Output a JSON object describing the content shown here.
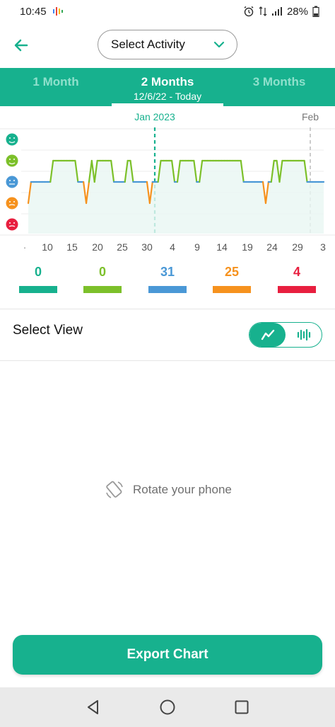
{
  "status_bar": {
    "time": "10:45",
    "battery": "28%"
  },
  "header": {
    "select_activity_label": "Select Activity"
  },
  "tabs": [
    {
      "label": "1 Month",
      "sub": ""
    },
    {
      "label": "2 Months",
      "sub": "12/6/22 - Today"
    },
    {
      "label": "3 Months",
      "sub": ""
    }
  ],
  "chart_data": {
    "type": "line",
    "month_labels": [
      "Jan 2023",
      "Feb"
    ],
    "x_tick_labels": [
      "10",
      "15",
      "20",
      "25",
      "30",
      "4",
      "9",
      "14",
      "19",
      "24",
      "29",
      "3"
    ],
    "y_categories": [
      "rad",
      "good",
      "meh",
      "bad",
      "awful"
    ],
    "y_colors": [
      "#17b18e",
      "#7cc02a",
      "#4a98d6",
      "#f6921e",
      "#e81f3f"
    ],
    "series": [
      {
        "values": [
          1,
          2,
          2,
          2,
          2,
          2,
          2,
          2,
          2,
          3,
          3,
          3,
          3,
          3,
          3,
          3,
          3,
          3,
          2,
          2,
          2,
          1,
          2,
          3,
          2,
          3,
          3,
          3,
          3,
          3,
          3,
          2,
          2,
          2,
          2,
          2,
          3,
          3,
          2,
          2,
          2,
          2,
          2,
          2,
          1,
          2,
          2,
          2,
          3,
          3,
          3,
          3,
          3,
          2,
          2,
          3,
          3,
          3,
          3,
          3,
          3,
          2,
          2,
          3,
          3,
          3,
          3,
          3,
          3,
          3,
          3,
          3,
          3,
          3,
          3,
          3,
          3,
          3,
          2,
          2,
          2,
          2,
          2,
          2,
          2,
          2,
          1,
          2,
          2,
          3,
          3,
          2,
          3,
          3,
          3,
          3,
          3,
          3,
          3,
          3,
          3,
          2,
          2,
          2,
          2,
          2,
          2,
          2
        ]
      }
    ],
    "ylim": [
      0,
      4
    ]
  },
  "totals": [
    {
      "value": "0",
      "color": "#17b18e"
    },
    {
      "value": "0",
      "color": "#7cc02a"
    },
    {
      "value": "31",
      "color": "#4a98d6"
    },
    {
      "value": "25",
      "color": "#f6921e"
    },
    {
      "value": "4",
      "color": "#e81f3f"
    }
  ],
  "select_view": {
    "label": "Select View"
  },
  "rotate_hint": "Rotate your phone",
  "export_button": "Export Chart",
  "colors": {
    "accent": "#17b18e"
  }
}
